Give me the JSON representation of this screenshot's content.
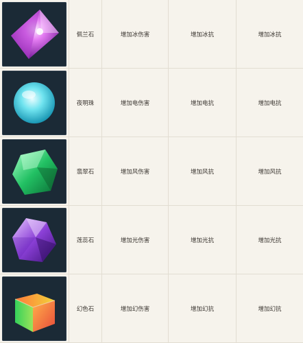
{
  "gems": [
    {
      "icon": "purple-crystal-icon",
      "name": "佩兰石",
      "effect1": "增加冰伤害",
      "effect2": "增加冰抗",
      "effect3": "增加冰抗"
    },
    {
      "icon": "cyan-orb-icon",
      "name": "夜明珠",
      "effect1": "增加电伤害",
      "effect2": "增加电抗",
      "effect3": "增加电抗"
    },
    {
      "icon": "green-gem-icon",
      "name": "翡翠石",
      "effect1": "增加风伤害",
      "effect2": "增加风抗",
      "effect3": "增加风抗"
    },
    {
      "icon": "violet-crystal-icon",
      "name": "莲蕊石",
      "effect1": "增加光伤害",
      "effect2": "增加光抗",
      "effect3": "增加光抗"
    },
    {
      "icon": "rainbow-cube-icon",
      "name": "幻色石",
      "effect1": "增加幻伤害",
      "effect2": "增加幻抗",
      "effect3": "增加幻抗"
    }
  ]
}
